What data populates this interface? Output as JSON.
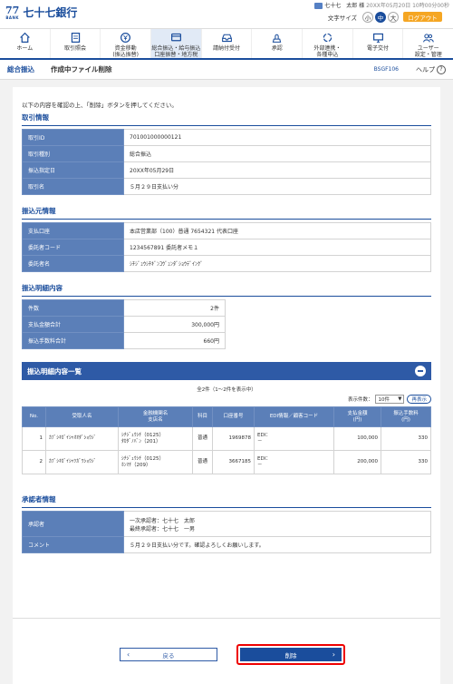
{
  "header": {
    "logo_mark": "77",
    "logo_sub": "BANK",
    "logo_text": "七十七銀行",
    "user_name": "七十七　太郎 様",
    "last_login": "20XX年05月20日 10時00分00秒",
    "font_size_label": "文字サイズ",
    "font_sizes": [
      "小",
      "中",
      "大"
    ],
    "logout": "ログアウト"
  },
  "nav": [
    {
      "label": "ホーム",
      "icon": "home-icon"
    },
    {
      "label": "取引照会",
      "icon": "document-icon"
    },
    {
      "label": "資金移動\n(振込振替)",
      "icon": "yen-transfer-icon"
    },
    {
      "label": "総合振込・給与振込\n口座振替・地方税",
      "icon": "card-icon"
    },
    {
      "label": "請納付受付",
      "icon": "tray-icon"
    },
    {
      "label": "承認",
      "icon": "approval-icon"
    },
    {
      "label": "外部連携・\n各種申込",
      "icon": "link-icon"
    },
    {
      "label": "電子交付",
      "icon": "electronic-delivery-icon"
    },
    {
      "label": "ユーザー\n設定・管理",
      "icon": "users-icon"
    }
  ],
  "title": {
    "section": "総合振込",
    "page": "作成中ファイル削除",
    "code": "BSGF106",
    "help": "ヘルプ"
  },
  "intro": "以下の内容を確認の上、「削除」ボタンを押してください。",
  "transaction": {
    "heading": "取引情報",
    "rows": [
      {
        "k": "取引ID",
        "v": "701001000000121"
      },
      {
        "k": "取引種別",
        "v": "総合振込"
      },
      {
        "k": "振込指定日",
        "v": "20XX年05月29日"
      },
      {
        "k": "取引名",
        "v": "５月２９日支払い分"
      }
    ]
  },
  "source": {
    "heading": "振込元情報",
    "rows": [
      {
        "k": "支払口座",
        "v": "本店営業部（100）普通 7654321 代表口座"
      },
      {
        "k": "委託者コード",
        "v": "1234567891 委託者メモ１"
      },
      {
        "k": "委託者名",
        "v": "ｼﾁｼﾞｭｳｼﾁｷﾞﾝｺｳﾞｭﾝﾀﾞｼｮｳﾃﾞｲﾝｸﾞ"
      }
    ]
  },
  "details": {
    "heading": "振込明細内容",
    "rows": [
      {
        "k": "件数",
        "v": "2件"
      },
      {
        "k": "支払金額合計",
        "v": "300,000円"
      },
      {
        "k": "振込手数料合計",
        "v": "660円"
      }
    ]
  },
  "list": {
    "heading": "振込明細内容一覧",
    "count": "全2件（1〜2件を表示中）",
    "display_label": "表示件数：",
    "display_value": "10件",
    "redisplay": "再表示",
    "columns": [
      "No.",
      "受取人名",
      "金融機関名\n支店名",
      "科目",
      "口座番号",
      "EDI情報／顧客コード",
      "支払金額\n(円)",
      "振込手数料\n(円)"
    ],
    "rows": [
      {
        "no": "1",
        "name": "ｶﾌﾞｼｷｶﾞｲｼｬｵｵﾀﾞｼｮｳｼﾞ",
        "bank": "ｼﾁｼﾞｭｳｼﾁ（0125）",
        "branch": "ﾀｶﾀﾞﾉﾊﾞﾝ（201）",
        "type": "普通",
        "account": "1969878",
        "edi1": "EDI：",
        "edi2": "－",
        "amount": "100,000",
        "fee": "330"
      },
      {
        "no": "2",
        "name": "ｶﾌﾞｼｷｶﾞｲｼｬﾂｶﾞﾜｼｮｳｼﾞ",
        "bank": "ｼﾁｼﾞｭｳｼﾁ（0125）",
        "branch": "ﾎﾝﾏﾁ（209）",
        "type": "普通",
        "account": "3667185",
        "edi1": "EDI：",
        "edi2": "－",
        "amount": "200,000",
        "fee": "330"
      }
    ]
  },
  "approver": {
    "heading": "承認者情報",
    "approver_label": "承認者",
    "approver1": "一次承認者：七十七　太郎",
    "approver2": "最終承認者：七十七　一男",
    "comment_label": "コメント",
    "comment": "５月２９日支払い分です。確認よろしくお願いします。"
  },
  "buttons": {
    "back": "戻る",
    "delete": "削除"
  }
}
